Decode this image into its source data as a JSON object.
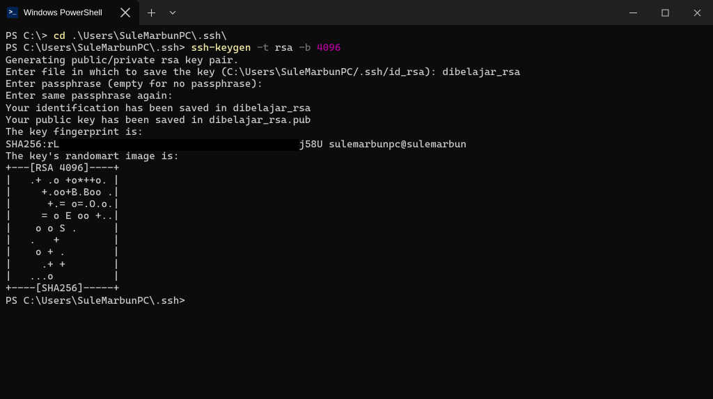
{
  "titlebar": {
    "tab_title": "Windows PowerShell",
    "tab_icon_text": ">_"
  },
  "terminal": {
    "prompt1": "PS C:\\> ",
    "cmd1": "cd",
    "arg1": " .\\Users\\SuleMarbunPC\\.ssh\\",
    "prompt2": "PS C:\\Users\\SuleMarbunPC\\.ssh> ",
    "cmd2": "ssh-keygen",
    "flag_t": " -t",
    "val_t": " rsa",
    "flag_b": " -b",
    "val_b": " 4096",
    "line_gen": "Generating public/private rsa key pair.",
    "line_enter_file": "Enter file in which to save the key (C:\\Users\\SuleMarbunPC/.ssh/id_rsa): dibelajar_rsa",
    "line_pass1": "Enter passphrase (empty for no passphrase):",
    "line_pass2": "Enter same passphrase again:",
    "line_id_saved": "Your identification has been saved in dibelajar_rsa",
    "line_pub_saved": "Your public key has been saved in dibelajar_rsa.pub",
    "line_fp_is": "The key fingerprint is:",
    "fp_prefix": "SHA256:rL",
    "fp_redacted_spacer": "                                        ",
    "fp_suffix": "j58U sulemarbunpc@sulemarbun",
    "line_randomart": "The key's randomart image is:",
    "ra": [
      "+---[RSA 4096]----+",
      "|   .+ .o +o*++o. |",
      "|     +.oo+B.Boo .|",
      "|      +.= o=.O.o.|",
      "|     = o E oo +..|",
      "|    o o S .      |",
      "|   .   +         |",
      "|    o + .        |",
      "|     .+ +        |",
      "|   ...o          |",
      "+----[SHA256]-----+"
    ],
    "prompt3": "PS C:\\Users\\SuleMarbunPC\\.ssh>"
  }
}
